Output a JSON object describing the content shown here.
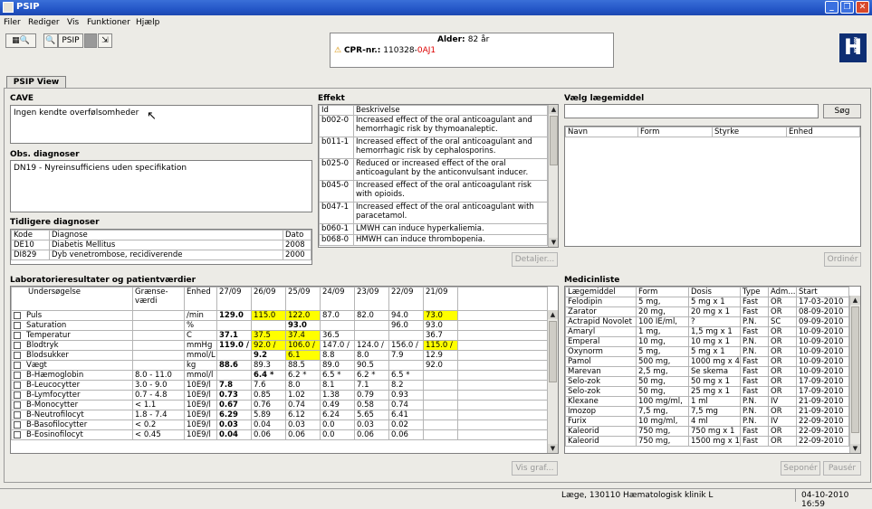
{
  "window": {
    "title": "PSIP"
  },
  "menu": [
    "Filer",
    "Rediger",
    "Vis",
    "Funktioner",
    "Hjælp"
  ],
  "toolbar": {
    "psip_label": "PSIP"
  },
  "patient": {
    "age_label": "Alder:",
    "age_value": "82 år",
    "cpr_label": "CPR-nr.:",
    "cpr_value_black": "110328-",
    "cpr_value_red": "0AJ1"
  },
  "logo_text": "H",
  "logo_region": "REGION",
  "tab": "PSIP View",
  "cave": {
    "label": "CAVE",
    "text": "Ingen kendte overfølsomheder"
  },
  "obs": {
    "label": "Obs. diagnoser",
    "text": "DN19 - Nyreinsufficiens uden specifikation"
  },
  "tidligere": {
    "label": "Tidligere diagnoser",
    "headers": [
      "Kode",
      "Diagnose",
      "Dato"
    ],
    "rows": [
      [
        "DE10",
        "Diabetis Mellitus",
        "2008"
      ],
      [
        "DI829",
        "Dyb venetrombose, recidiverende",
        "2000"
      ]
    ]
  },
  "effekt": {
    "label": "Effekt",
    "headers": [
      "Id",
      "Beskrivelse"
    ],
    "rows": [
      [
        "b002-0",
        "Increased effect of the oral anticoagulant and hemorrhagic risk by thymoanaleptic."
      ],
      [
        "b011-1",
        "Increased effect of the oral anticoagulant and hemorrhagic risk by cephalosporins."
      ],
      [
        "b025-0",
        "Reduced or increased effect of the oral anticoagulant by the anticonvulsant inducer."
      ],
      [
        "b045-0",
        "Increased effect of the oral anticoagulant risk with opioids."
      ],
      [
        "b047-1",
        "Increased effect of the oral anticoagulant with paracetamol."
      ],
      [
        "b060-1",
        "LMWH can induce hyperkaliemia."
      ],
      [
        "b068-0",
        "HMWH can induce thrombopenia."
      ]
    ],
    "detail_button": "Detaljer..."
  },
  "vaelg": {
    "label": "Vælg lægemiddel",
    "search_button": "Søg",
    "headers": [
      "Navn",
      "Form",
      "Styrke",
      "Enhed"
    ],
    "ordiner_button": "Ordinér"
  },
  "lab": {
    "label": "Laboratorieresultater og patientværdier",
    "headers": [
      "Undersøgelse",
      "Grænse-værdi",
      "Enhed",
      "27/09",
      "26/09",
      "25/09",
      "24/09",
      "23/09",
      "22/09",
      "21/09"
    ],
    "rows": [
      [
        "Puls",
        "",
        "/min",
        "129.0",
        "115.0",
        "122.0",
        "87.0",
        "82.0",
        "94.0",
        "73.0"
      ],
      [
        "Saturation",
        "",
        "%",
        "",
        "",
        "93.0",
        "",
        "",
        "96.0",
        "93.0"
      ],
      [
        "Temperatur",
        "",
        "C",
        "37.1",
        "37.5",
        "37.4",
        "36.5",
        "",
        "",
        "36.7"
      ],
      [
        "Blodtryk",
        "",
        "mmHg",
        "119.0 /",
        "92.0 /",
        "106.0 /",
        "147.0 /",
        "124.0 /",
        "156.0 /",
        "115.0 /"
      ],
      [
        "Blodsukker",
        "",
        "mmol/L",
        "",
        "9.2",
        "6.1",
        "8.8",
        "8.0",
        "7.9",
        "12.9"
      ],
      [
        "Vægt",
        "",
        "kg",
        "88.6",
        "89.3",
        "88.5",
        "89.0",
        "90.5",
        "",
        "92.0"
      ],
      [
        "B-Hæmoglobin",
        "8.0 - 11.0",
        "mmol/l",
        "",
        "6.4 *",
        "6.2 *",
        "6.5 *",
        "6.2 *",
        "6.5 *",
        ""
      ],
      [
        "B-Leucocytter",
        "3.0 - 9.0",
        "10E9/l",
        "7.8",
        "7.6",
        "8.0",
        "8.1",
        "7.1",
        "8.2",
        ""
      ],
      [
        "B-Lymfocytter",
        "0.7 - 4.8",
        "10E9/l",
        "0.73",
        "0.85",
        "1.02",
        "1.38",
        "0.79",
        "0.93",
        ""
      ],
      [
        "B-Monocytter",
        "< 1.1",
        "10E9/l",
        "0.67",
        "0.76",
        "0.74",
        "0.49",
        "0.58",
        "0.74",
        ""
      ],
      [
        "B-Neutrofilocyt",
        "1.8 - 7.4",
        "10E9/l",
        "6.29",
        "5.89",
        "6.12",
        "6.24",
        "5.65",
        "6.41",
        ""
      ],
      [
        "B-Basofilocytter",
        "< 0.2",
        "10E9/l",
        "0.03",
        "0.04",
        "0.03",
        "0.0",
        "0.03",
        "0.02",
        ""
      ],
      [
        "B-Eosinofilocyt",
        "< 0.45",
        "10E9/l",
        "0.04",
        "0.06",
        "0.06",
        "0.0",
        "0.06",
        "0.06",
        ""
      ]
    ],
    "graph_button": "Vis graf..."
  },
  "medicin": {
    "label": "Medicinliste",
    "headers": [
      "Lægemiddel",
      "Form",
      "Dosis",
      "Type",
      "Adm...",
      "Start"
    ],
    "rows": [
      [
        "Felodipin",
        "5 mg,",
        "5 mg x 1",
        "Fast",
        "OR",
        "17-03-2010"
      ],
      [
        "Zarator",
        "20 mg,",
        "20 mg x 1",
        "Fast",
        "OR",
        "08-09-2010"
      ],
      [
        "Actrapid Novolet",
        "100 IE/ml,",
        "?",
        "P.N.",
        "SC",
        "09-09-2010"
      ],
      [
        "Amaryl",
        "1 mg,",
        "1,5 mg x 1",
        "Fast",
        "OR",
        "10-09-2010"
      ],
      [
        "Emperal",
        "10 mg,",
        "10 mg x 1",
        "P.N.",
        "OR",
        "10-09-2010"
      ],
      [
        "Oxynorm",
        "5 mg,",
        "5 mg x 1",
        "P.N.",
        "OR",
        "10-09-2010"
      ],
      [
        "Pamol",
        "500 mg,",
        "1000 mg x 4",
        "Fast",
        "OR",
        "10-09-2010"
      ],
      [
        "Marevan",
        "2,5 mg,",
        "Se skema",
        "Fast",
        "OR",
        "10-09-2010"
      ],
      [
        "Selo-zok",
        "50 mg,",
        "50 mg x 1",
        "Fast",
        "OR",
        "17-09-2010"
      ],
      [
        "Selo-zok",
        "50 mg,",
        "25 mg x 1",
        "Fast",
        "OR",
        "17-09-2010"
      ],
      [
        "Klexane",
        "100 mg/ml,",
        "1 ml",
        "P.N.",
        "IV",
        "21-09-2010"
      ],
      [
        "Imozop",
        "7,5 mg,",
        "7,5 mg",
        "P.N.",
        "OR",
        "21-09-2010"
      ],
      [
        "Furix",
        "10 mg/ml,",
        "4 ml",
        "P.N.",
        "IV",
        "22-09-2010"
      ],
      [
        "Kaleorid",
        "750 mg,",
        "750 mg x 1",
        "Fast",
        "OR",
        "22-09-2010"
      ],
      [
        "Kaleorid",
        "750 mg,",
        "1500 mg x 1",
        "Fast",
        "OR",
        "22-09-2010"
      ]
    ],
    "seponer_button": "Seponér",
    "pauser_button": "Pausér"
  },
  "status": {
    "user": "Læge, 130110 Hæmatologisk klinik L",
    "datetime": "04-10-2010 16:59"
  },
  "highlight_color": "#ffff00",
  "lab_bold_col": 3,
  "lab_highlights": [
    [
      0,
      4
    ],
    [
      0,
      5
    ],
    [
      0,
      9
    ],
    [
      2,
      4
    ],
    [
      2,
      5
    ],
    [
      3,
      4
    ],
    [
      3,
      5
    ],
    [
      3,
      9
    ],
    [
      4,
      5
    ]
  ],
  "lab_bold_cells": [
    [
      1,
      5
    ],
    [
      4,
      4
    ],
    [
      6,
      4
    ]
  ]
}
